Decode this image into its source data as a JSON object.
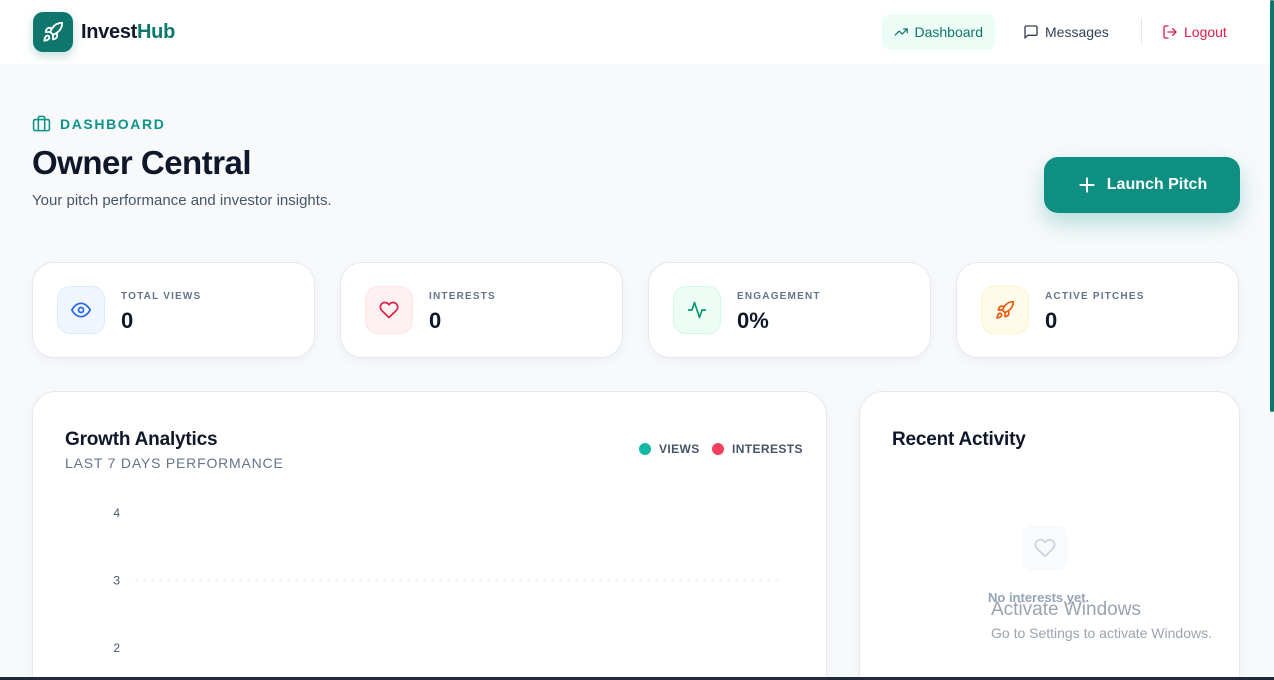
{
  "brand": {
    "part1": "Invest",
    "part2": "Hub",
    "icon": "rocket-icon"
  },
  "nav": {
    "dashboard": "Dashboard",
    "messages": "Messages",
    "logout": "Logout"
  },
  "header": {
    "eyebrow": "DASHBOARD",
    "title": "Owner Central",
    "subtitle": "Your pitch performance and investor insights.",
    "launch_label": "Launch Pitch"
  },
  "stats": [
    {
      "label": "TOTAL VIEWS",
      "value": "0",
      "icon": "eye-icon",
      "color": "#2563eb"
    },
    {
      "label": "INTERESTS",
      "value": "0",
      "icon": "heart-icon",
      "color": "#e11d48"
    },
    {
      "label": "ENGAGEMENT",
      "value": "0%",
      "icon": "activity-icon",
      "color": "#059669"
    },
    {
      "label": "ACTIVE PITCHES",
      "value": "0",
      "icon": "rocket-icon",
      "color": "#ea580c"
    }
  ],
  "growth": {
    "title": "Growth Analytics",
    "subtitle": "LAST 7 DAYS PERFORMANCE"
  },
  "chart_data": {
    "type": "line",
    "series": [
      {
        "name": "VIEWS",
        "color": "#14b8a6",
        "values": []
      },
      {
        "name": "INTERESTS",
        "color": "#f43f5e",
        "values": []
      }
    ],
    "yticks": [
      "4",
      "3",
      "2"
    ],
    "legend": "top-right",
    "grid": true
  },
  "activity": {
    "title": "Recent Activity",
    "empty_text": "No interests yet."
  },
  "watermark": {
    "title": "Activate Windows",
    "subtitle": "Go to Settings to activate Windows."
  }
}
